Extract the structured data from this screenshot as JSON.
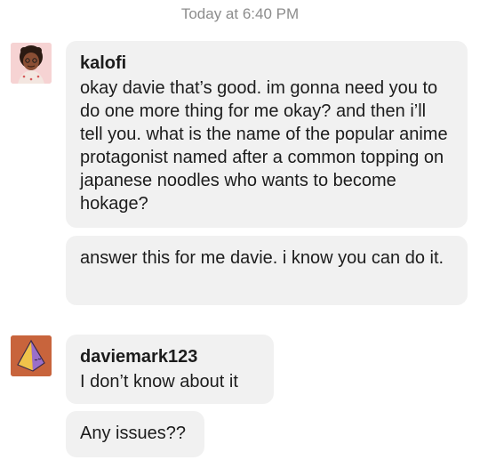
{
  "conversation": {
    "timestamp": "Today at 6:40 PM",
    "messages": [
      {
        "sender": "kalofi",
        "avatar_icon": "person-avatar",
        "text": "okay davie that’s good. im gonna need you to do one more thing for me okay? and then i’ll tell you. what is the name of the popular anime protagonist named after a common topping on japanese noodles who wants to become hokage?"
      },
      {
        "sender": "kalofi",
        "text": "answer this for me davie. i know you can do it."
      },
      {
        "sender": "daviemark123",
        "avatar_icon": "pyramid-avatar",
        "text": "I don’t know about it"
      },
      {
        "sender": "daviemark123",
        "text": "Any issues??"
      }
    ]
  },
  "colors": {
    "bubble": "#f1f1f1",
    "kalofi_avatar_bg": "#f6d3d3",
    "davie_avatar_bg": "#c8643c"
  }
}
